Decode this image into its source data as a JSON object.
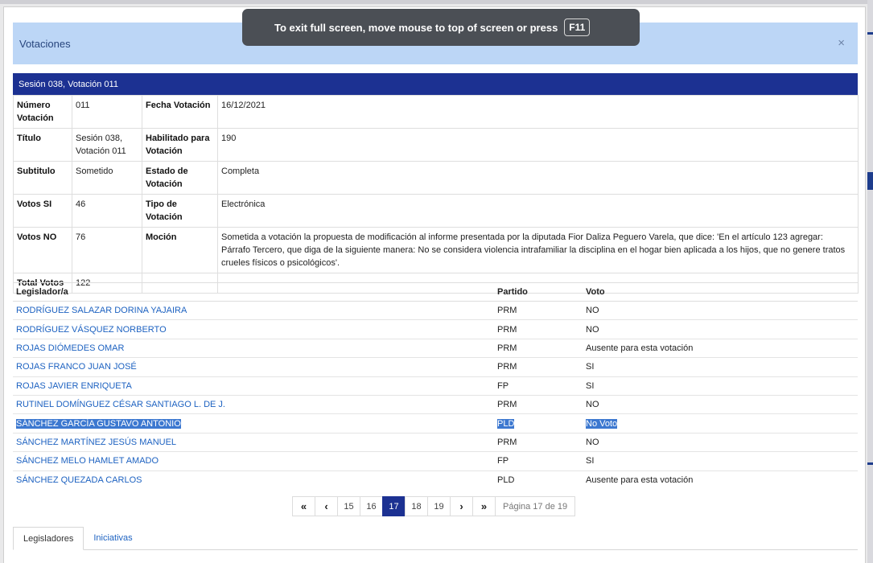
{
  "toast": {
    "message": "To exit full screen, move mouse to top of screen or press",
    "key": "F11"
  },
  "modal": {
    "title": "Votaciones",
    "close": "×"
  },
  "section": {
    "title": "Sesión 038, Votación 011"
  },
  "info": {
    "numero_label": "Número Votación",
    "numero_value": "011",
    "fecha_label": "Fecha Votación",
    "fecha_value": "16/12/2021",
    "titulo_label": "Título",
    "titulo_value": "Sesión 038, Votación 011",
    "habilitado_label": "Habilitado para Votación",
    "habilitado_value": "190",
    "subtitulo_label": "Subtitulo",
    "subtitulo_value": "Sometido",
    "estado_label": "Estado de Votación",
    "estado_value": "Completa",
    "votos_si_label": "Votos SI",
    "votos_si_value": "46",
    "tipo_label": "Tipo de Votación",
    "tipo_value": "Electrónica",
    "votos_no_label": "Votos NO",
    "votos_no_value": "76",
    "mocion_label": "Moción",
    "mocion_value": "Sometida a votación la propuesta de modificación al informe presentada por la diputada Fior Daliza Peguero Varela, que dice: 'En el artículo 123 agregar: Párrafo Tercero, que diga de la siguiente manera: No se considera violencia intrafamiliar la disciplina en el hogar bien aplicada a los hijos, que no genere tratos crueles físicos o psicológicos'.",
    "total_label": "Total Votos",
    "total_value": "122"
  },
  "legislators": {
    "headers": {
      "name": "Legislador/a",
      "party": "Partido",
      "vote": "Voto"
    },
    "rows": [
      {
        "name": "RODRÍGUEZ SALAZAR DORINA YAJAIRA",
        "party": "PRM",
        "vote": "NO"
      },
      {
        "name": "RODRÍGUEZ VÁSQUEZ NORBERTO",
        "party": "PRM",
        "vote": "NO"
      },
      {
        "name": "ROJAS DIÓMEDES OMAR",
        "party": "PRM",
        "vote": "Ausente para esta votación"
      },
      {
        "name": "ROJAS FRANCO JUAN JOSÉ",
        "party": "PRM",
        "vote": "SI"
      },
      {
        "name": "ROJAS JAVIER ENRIQUETA",
        "party": "FP",
        "vote": "SI"
      },
      {
        "name": "RUTINEL DOMÍNGUEZ CÉSAR SANTIAGO L. DE J.",
        "party": "PRM",
        "vote": "NO"
      },
      {
        "name": "SÁNCHEZ GARCÍA GUSTAVO ANTONIO",
        "party": "PLD",
        "vote": "No Voto"
      },
      {
        "name": "SÁNCHEZ MARTÍNEZ JESÚS MANUEL",
        "party": "PRM",
        "vote": "NO"
      },
      {
        "name": "SÁNCHEZ MELO HAMLET AMADO",
        "party": "FP",
        "vote": "SI"
      },
      {
        "name": "SÁNCHEZ QUEZADA CARLOS",
        "party": "PLD",
        "vote": "Ausente para esta votación"
      }
    ]
  },
  "pager": {
    "first": "«",
    "prev": "‹",
    "next": "›",
    "last": "»",
    "pages": [
      "15",
      "16",
      "17",
      "18",
      "19"
    ],
    "active_page": "17",
    "info": "Página 17 de 19"
  },
  "tabs": [
    {
      "label": "Legisladores"
    },
    {
      "label": "Iniciativas"
    }
  ],
  "colors": {
    "header_bar": "#1c3192",
    "modal_header": "#bcd6f6",
    "link": "#1d62c1",
    "selection": "#3c78d0"
  }
}
